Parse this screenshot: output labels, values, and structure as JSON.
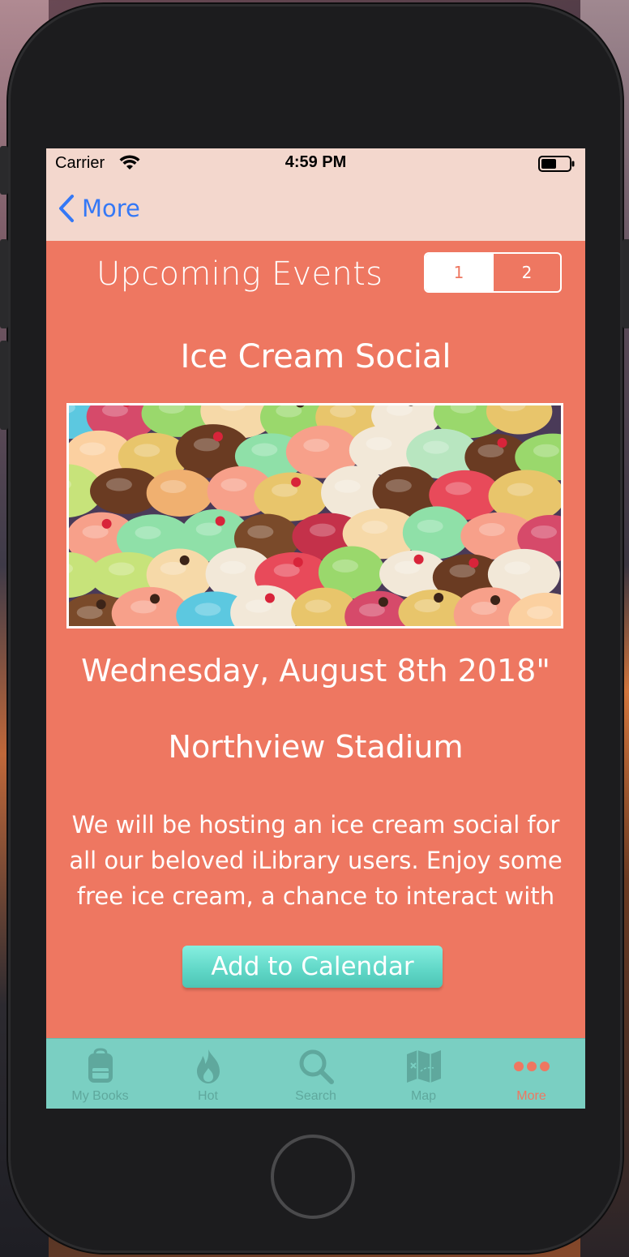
{
  "status_bar": {
    "carrier": "Carrier",
    "time": "4:59 PM",
    "wifi_icon": "wifi-icon",
    "battery_icon": "battery-icon"
  },
  "nav": {
    "back_label": "More",
    "back_icon": "chevron-left-icon"
  },
  "content": {
    "section_title": "Upcoming Events",
    "segments": [
      {
        "label": "1",
        "selected": true
      },
      {
        "label": "2",
        "selected": false
      }
    ],
    "event": {
      "title": "Ice Cream Social",
      "date": "Wednesday, August 8th 2018\"",
      "location": "Northview Stadium",
      "description": "We will be hosting an ice cream social for all our beloved iLibrary users. Enjoy some free ice cream, a chance to interact with",
      "image_subject": "ice-cream-scoops-photo"
    },
    "add_button_label": "Add to Calendar"
  },
  "tab_bar": {
    "items": [
      {
        "label": "My Books",
        "icon": "backpack-icon",
        "active": false
      },
      {
        "label": "Hot",
        "icon": "flame-icon",
        "active": false
      },
      {
        "label": "Search",
        "icon": "search-icon",
        "active": false
      },
      {
        "label": "Map",
        "icon": "map-icon",
        "active": false
      },
      {
        "label": "More",
        "icon": "more-icon",
        "active": true
      }
    ]
  },
  "colors": {
    "accent": "#ee7761",
    "nav_background": "#f3d7cd",
    "tab_background": "#7acfc2",
    "link_blue": "#3478f6",
    "button_teal": "#5fd6c6"
  }
}
